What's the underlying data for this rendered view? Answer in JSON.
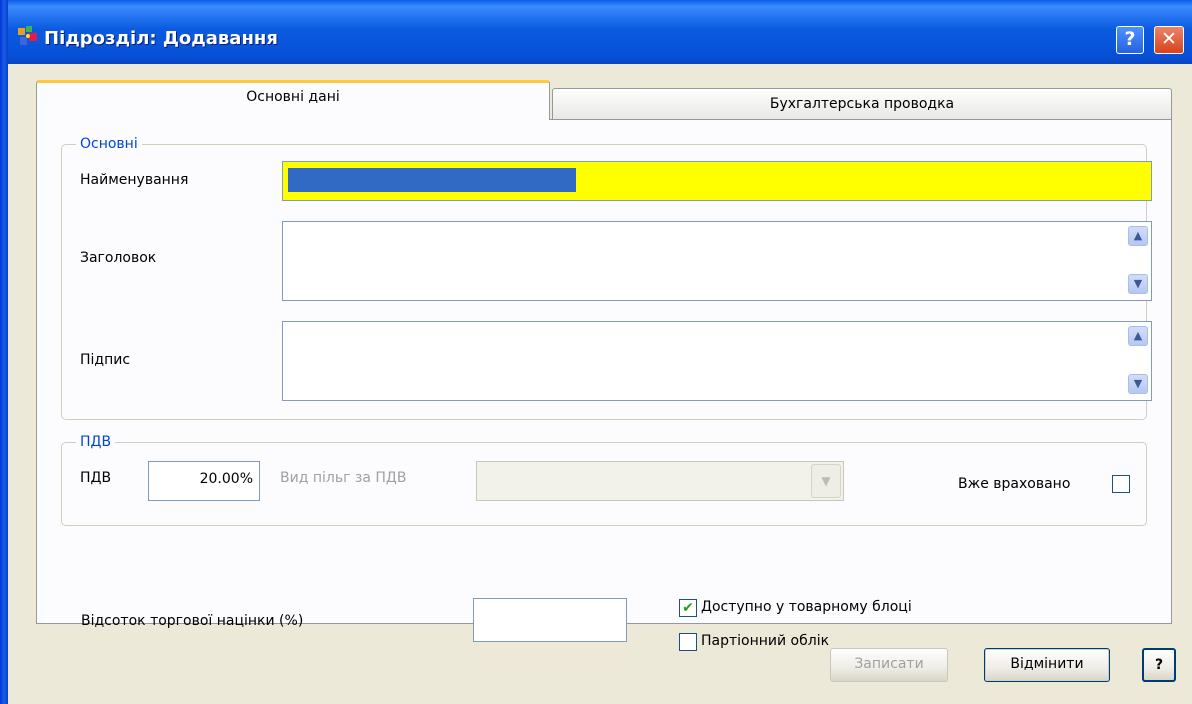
{
  "window": {
    "title": "Підрозділ: Додавання",
    "help_button": "?",
    "close_button": "✕"
  },
  "tabs": [
    {
      "label": "Основні дані",
      "active": true
    },
    {
      "label": "Бухгалтерська проводка",
      "active": false
    }
  ],
  "group_main": {
    "legend": "Основні",
    "name_label": "Найменування",
    "name_value_selected": true,
    "header_label": "Заголовок",
    "signature_label": "Підпис",
    "scroll_up": "▲",
    "scroll_down": "▼"
  },
  "group_vat": {
    "legend": "ПДВ",
    "vat_label": "ПДВ",
    "vat_value": "20.00%",
    "benefit_label": "Вид пільг за ПДВ",
    "benefit_value": "",
    "combo_arrow": "▼",
    "already_counted_label": "Вже враховано",
    "already_counted_checked": false
  },
  "markup": {
    "label": "Відсоток торгової націнки (%)",
    "value": ""
  },
  "options": {
    "available_label": "Доступно у товарному блоці",
    "available_checked": true,
    "available_mark": "✔",
    "batch_label": "Партіонний облік",
    "batch_checked": false
  },
  "buttons": {
    "save": "Записати",
    "cancel": "Відмінити",
    "help": "?"
  },
  "colors": {
    "title_bar": "#0a5fe9",
    "required_field": "#ffff00",
    "selection": "#316ac5",
    "group_legend": "#0046d5",
    "active_tab_accent": "#ffc83c"
  },
  "icons": [
    "app-icon",
    "help-icon",
    "close-icon",
    "scroll-up-icon",
    "scroll-down-icon",
    "dropdown-arrow-icon",
    "checkmark-icon"
  ]
}
